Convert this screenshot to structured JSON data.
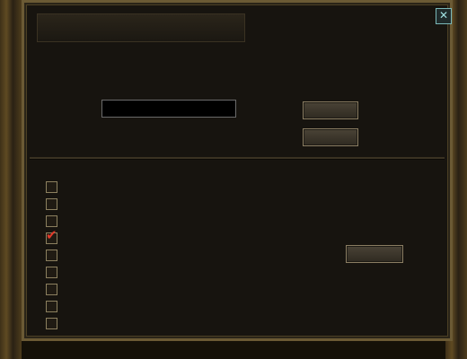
{
  "dialog": {
    "title": "",
    "close_glyph": "✕",
    "intro": "",
    "notice": ""
  },
  "form": {
    "guild_name_value": "",
    "apply_label": "",
    "cancel_label": ""
  },
  "status_line": "",
  "list": {
    "headers": {
      "name": "",
      "count": ""
    },
    "rows": [
      {
        "name": "",
        "count": "",
        "checked": false
      },
      {
        "name": "",
        "count": "",
        "checked": false
      },
      {
        "name": "",
        "count": "",
        "checked": false
      },
      {
        "name": "",
        "count": "",
        "checked": true
      },
      {
        "name": "",
        "count": "",
        "checked": false
      },
      {
        "name": "",
        "count": "",
        "checked": false
      },
      {
        "name": "",
        "count": "",
        "checked": false
      },
      {
        "name": "",
        "count": "",
        "checked": false
      },
      {
        "name": "",
        "count": "",
        "checked": false
      }
    ],
    "apply_now_label": "",
    "prev_page_label": "",
    "next_page_label": ""
  },
  "side_tags": {
    "left": [
      {
        "text": "",
        "color": "#2fd04a"
      },
      {
        "text": "",
        "color": "#2fd04a"
      },
      {
        "text": "",
        "color": "#2fd04a"
      },
      {
        "text": "",
        "color": "#ffffff"
      }
    ],
    "right": [
      {
        "text": "",
        "color": "#2fd04a"
      },
      {
        "text": "",
        "color": "#2fd04a"
      }
    ]
  },
  "watermark": "",
  "colors": {
    "accent_green": "#3bd65a",
    "checkmark_red": "#e23a2a",
    "frame_gold": "#6b5a34"
  }
}
